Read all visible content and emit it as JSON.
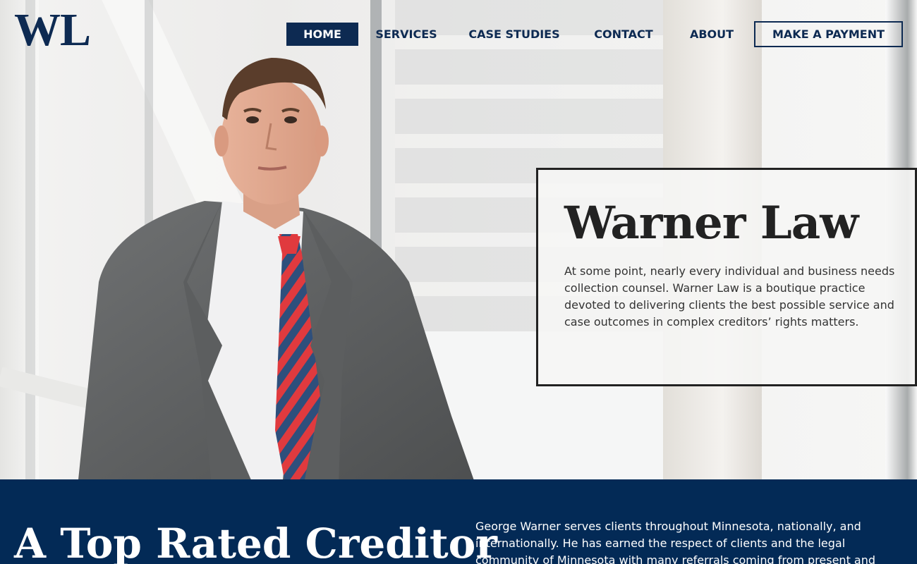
{
  "header": {
    "logo_text": "WL",
    "nav": [
      {
        "label": "HOME",
        "active": true
      },
      {
        "label": "SERVICES",
        "active": false
      },
      {
        "label": "CASE STUDIES",
        "active": false
      },
      {
        "label": "CONTACT",
        "active": false
      },
      {
        "label": "ABOUT",
        "active": false
      }
    ],
    "payment_button": "MAKE A PAYMENT"
  },
  "hero": {
    "title": "Warner Law",
    "description": "At some point, nearly every individual and business needs collection counsel. Warner Law is a boutique practice devoted to delivering clients the best possible service and case outcomes in complex creditors’ rights matters."
  },
  "about": {
    "heading": "A Top Rated Creditor",
    "text": "George Warner serves clients throughout Minnesota, nationally, and internationally. He has earned the respect of clients and the legal community of Minnesota with many referrals coming from present and"
  },
  "colors": {
    "brand_navy": "#0d2a52",
    "section_navy": "#032a56",
    "tie_red": "#e03a3e",
    "tie_blue": "#2e4f7c"
  }
}
